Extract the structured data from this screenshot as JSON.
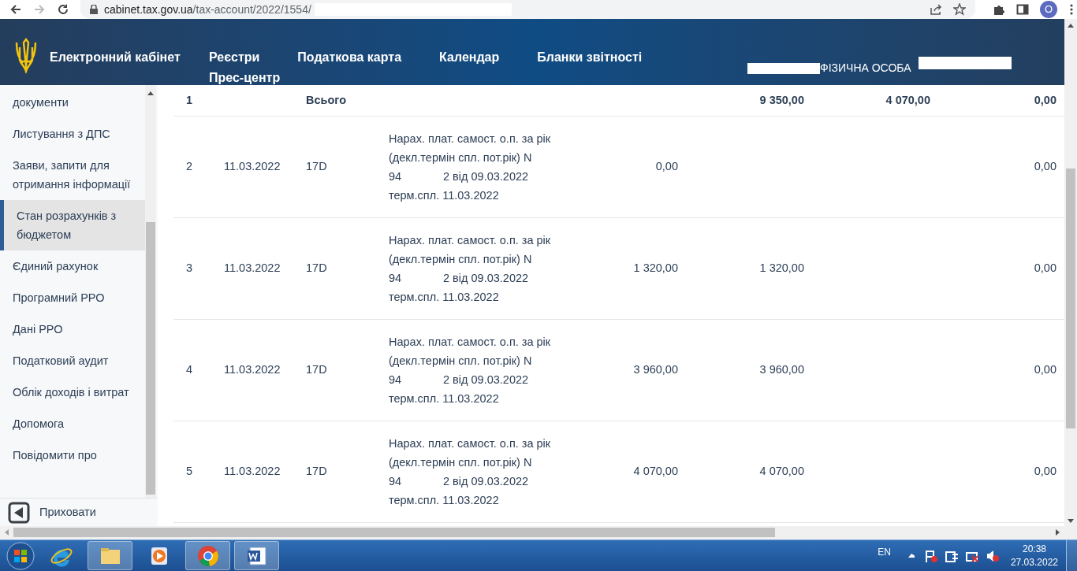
{
  "browser": {
    "url_host": "cabinet.tax.gov.ua",
    "url_path": "/tax-account/2022/1554/",
    "profile_initial": "O"
  },
  "header": {
    "title_lines": [
      "Електронний",
      "кабінет"
    ],
    "nav": [
      {
        "label": "Реєстри"
      },
      {
        "label": "Податкова карта"
      },
      {
        "label": "Календар"
      },
      {
        "label": "Бланки звітності"
      },
      {
        "label": "Прес-центр"
      }
    ],
    "user_type": "ФІЗИЧНА ОСОБА"
  },
  "sidebar": {
    "items": [
      {
        "label": "документи",
        "selected": false
      },
      {
        "label": "Листування з ДПС",
        "selected": false
      },
      {
        "label": "Заяви, запити для отримання інформації",
        "selected": false
      },
      {
        "label": "Стан розрахунків з бюджетом",
        "selected": true
      },
      {
        "label": "Єдиний рахунок",
        "selected": false
      },
      {
        "label": "Програмний РРО",
        "selected": false
      },
      {
        "label": "Дані РРО",
        "selected": false
      },
      {
        "label": "Податковий аудит",
        "selected": false
      },
      {
        "label": "Облік доходів і витрат",
        "selected": false
      },
      {
        "label": "Допомога",
        "selected": false
      },
      {
        "label": "Повідомити про",
        "selected": false
      }
    ],
    "hide_button": "Приховати"
  },
  "table": {
    "rows": [
      {
        "kind": "total",
        "number": "1",
        "code": "Всього",
        "column_6": "9 350,00",
        "column_7": "4 070,00",
        "column_8": "0,00"
      },
      {
        "kind": "entry",
        "number": "2",
        "date": "11.03.2022",
        "code": "17D",
        "description": [
          "Нарах. плат. самост. о.п. за рік",
          "(декл.термін спл. пот.рік) N",
          "94",
          "2 від 09.03.2022",
          "терм.спл. 11.03.2022"
        ],
        "column_5": "0,00",
        "column_8": "0,00"
      },
      {
        "kind": "entry",
        "number": "3",
        "date": "11.03.2022",
        "code": "17D",
        "description": [
          "Нарах. плат. самост. о.п. за рік",
          "(декл.термін спл. пот.рік) N",
          "94",
          "2 від 09.03.2022",
          "терм.спл. 11.03.2022"
        ],
        "column_5": "1 320,00",
        "column_6": "1 320,00",
        "column_8": "0,00"
      },
      {
        "kind": "entry",
        "number": "4",
        "date": "11.03.2022",
        "code": "17D",
        "description": [
          "Нарах. плат. самост. о.п. за рік",
          "(декл.термін спл. пот.рік) N",
          "94",
          "2 від 09.03.2022",
          "терм.спл. 11.03.2022"
        ],
        "column_5": "3 960,00",
        "column_6": "3 960,00",
        "column_8": "0,00"
      },
      {
        "kind": "entry",
        "number": "5",
        "date": "11.03.2022",
        "code": "17D",
        "description": [
          "Нарах. плат. самост. о.п. за рік",
          "(декл.термін спл. пот.рік) N",
          "94",
          "2 від 09.03.2022",
          "терм.спл. 11.03.2022"
        ],
        "column_5": "4 070,00",
        "column_6": "4 070,00",
        "column_8": "0,00"
      }
    ]
  },
  "taskbar": {
    "language": "EN",
    "time": "20:38",
    "date": "27.03.2022"
  }
}
